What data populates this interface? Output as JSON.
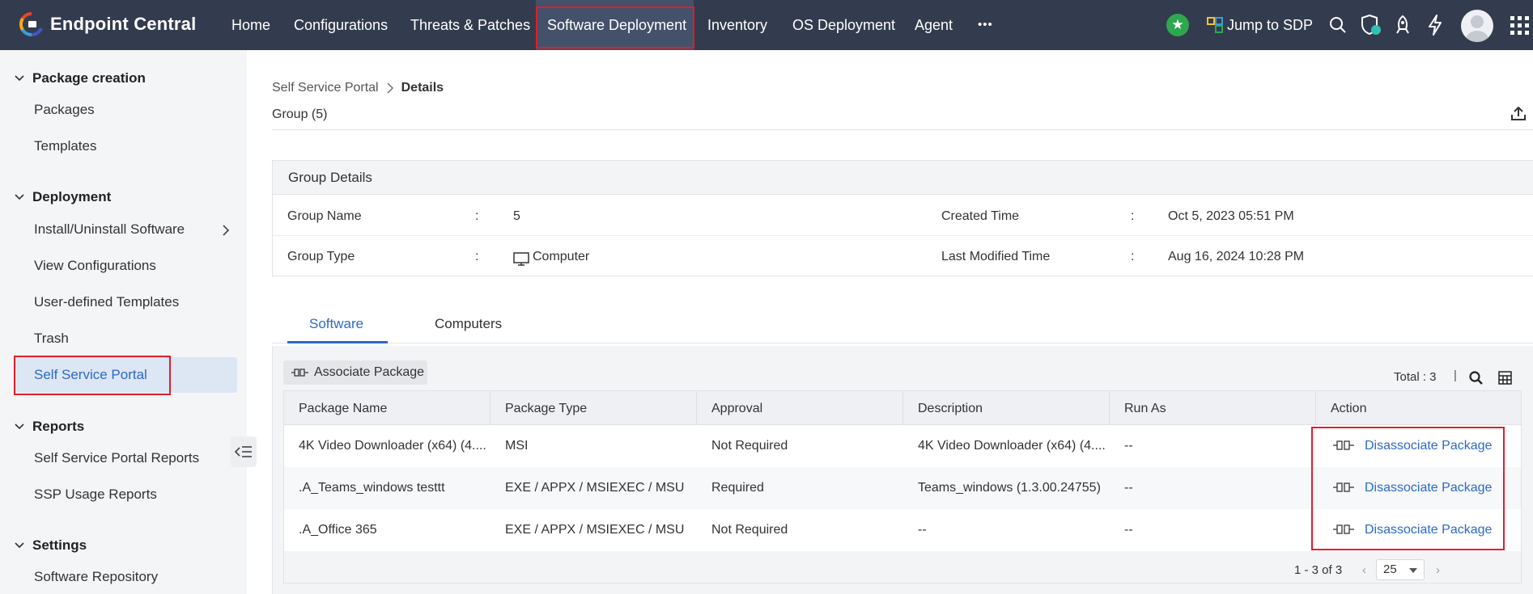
{
  "app": {
    "name": "Endpoint Central"
  },
  "nav": {
    "items": [
      "Home",
      "Configurations",
      "Threats & Patches",
      "Software Deployment",
      "Inventory",
      "OS Deployment",
      "Agent"
    ],
    "more": "•••",
    "jump": "Jump to SDP"
  },
  "sidebar": {
    "sections": [
      {
        "title": "Package creation",
        "items": [
          "Packages",
          "Templates"
        ]
      },
      {
        "title": "Deployment",
        "items": [
          "Install/Uninstall Software",
          "View Configurations",
          "User-defined Templates",
          "Trash",
          "Self Service Portal"
        ]
      },
      {
        "title": "Reports",
        "items": [
          "Self Service Portal Reports",
          "SSP Usage Reports"
        ]
      },
      {
        "title": "Settings",
        "items": [
          "Software Repository"
        ]
      }
    ]
  },
  "breadcrumb": {
    "parent": "Self Service Portal",
    "current": "Details"
  },
  "group_title": "Group (5)",
  "details": {
    "title": "Group Details",
    "colon": ":",
    "group_name_label": "Group Name",
    "group_name": "5",
    "group_type_label": "Group Type",
    "group_type": "Computer",
    "created_label": "Created Time",
    "created": "Oct 5, 2023 05:51 PM",
    "modified_label": "Last Modified Time",
    "modified": "Aug 16, 2024 10:28 PM"
  },
  "tabs": [
    "Software",
    "Computers"
  ],
  "toolbar": {
    "associate": "Associate Package",
    "total": "Total : 3",
    "sep": "|"
  },
  "table": {
    "columns": [
      "Package Name",
      "Package Type",
      "Approval",
      "Description",
      "Run As",
      "Action"
    ],
    "rows": [
      [
        "4K Video Downloader (x64) (4....",
        "MSI",
        "Not Required",
        "4K Video Downloader (x64) (4....",
        "--",
        "Disassociate Package"
      ],
      [
        ".A_Teams_windows testtt",
        "EXE / APPX / MSIEXEC / MSU",
        "Required",
        "Teams_windows (1.3.00.24755)",
        "--",
        "Disassociate Package"
      ],
      [
        ".A_Office 365",
        "EXE / APPX / MSIEXEC / MSU",
        "Not Required",
        "--",
        "--",
        "Disassociate Package"
      ]
    ]
  },
  "pager": {
    "range": "1 - 3 of 3",
    "per_page": "25",
    "prev": "‹",
    "next": "›"
  },
  "colors": {
    "topbar": "#333c4e",
    "accent": "#2a6ac9",
    "highlight": "#e01e2b",
    "star": "#2ea84f"
  },
  "icons": [
    "endpoint-central-logo",
    "star-icon",
    "sdp-icon",
    "search-icon",
    "shield-icon",
    "rocket-icon",
    "lightning-icon",
    "avatar",
    "apps-grid-icon",
    "chevron-down-icon",
    "chevron-right-icon",
    "collapse-sidebar-icon",
    "export-icon",
    "computer-icon",
    "package-icon",
    "table-columns-icon"
  ]
}
